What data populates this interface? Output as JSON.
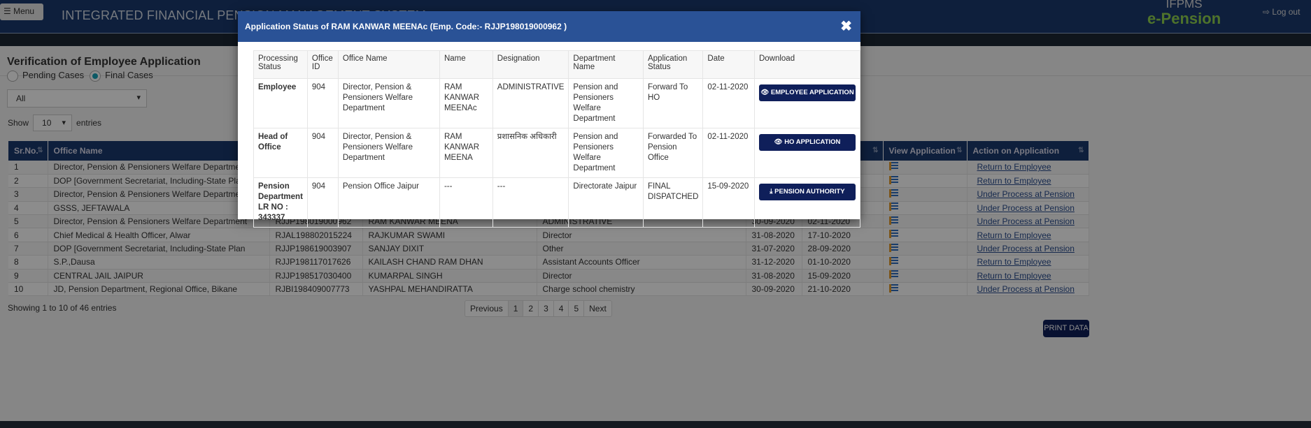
{
  "header": {
    "menu_label": "☰ Menu",
    "system_title": "INTEGRATED FINANCIAL PENSION MANAGEMENT SYSTEM",
    "brand_top": "IFPMS",
    "brand_bottom": "e-Pension",
    "logout_label": "⇨ Log out"
  },
  "page": {
    "title": "Verification of Employee Application",
    "radio_pending": "Pending Cases",
    "radio_final": "Final Cases",
    "selected_radio": "Final Cases",
    "filter_value": "All",
    "show_label": "Show",
    "entries_value": "10",
    "entries_label": "entries"
  },
  "table": {
    "headers": [
      "Sr.No.",
      "Office Name",
      "",
      "",
      "",
      "",
      "e",
      "View Application",
      "Action on Application"
    ],
    "rows": [
      [
        "1",
        "Director, Pension & Pensioners Welfare Department",
        "",
        "",
        "",
        "",
        "",
        "",
        "Return to Employee"
      ],
      [
        "2",
        "DOP [Government Secretariat, Including-State Plan]",
        "",
        "",
        "",
        "",
        "",
        "",
        "Return to Employee"
      ],
      [
        "3",
        "Director, Pension & Pensioners Welfare Department",
        "",
        "",
        "",
        "",
        "",
        "",
        "Under Process at Pension"
      ],
      [
        "4",
        "GSSS, JEFTAWALA",
        "",
        "",
        "",
        "",
        "",
        "",
        "Under Process at Pension"
      ],
      [
        "5",
        "Director, Pension & Pensioners Welfare Department",
        "RJJP198019000962",
        "RAM KANWAR MEENA",
        "ADMINISTRATIVE",
        "30-09-2020",
        "02-11-2020",
        "",
        "Under Process at Pension"
      ],
      [
        "6",
        "Chief Medical & Health Officer, Alwar",
        "RJAL198802015224",
        "RAJKUMAR SWAMI",
        "Director",
        "31-08-2020",
        "17-10-2020",
        "",
        "Return to Employee"
      ],
      [
        "7",
        "DOP [Government Secretariat, Including-State Plan",
        "RJJP198619003907",
        "SANJAY DIXIT",
        "Other",
        "31-07-2020",
        "28-09-2020",
        "",
        "Under Process at Pension"
      ],
      [
        "8",
        "S.P.,Dausa",
        "RJJP198117017626",
        "KAILASH CHAND RAM DHAN",
        "Assistant Accounts Officer",
        "31-12-2020",
        "01-10-2020",
        "",
        "Return to Employee"
      ],
      [
        "9",
        "CENTRAL JAIL JAIPUR",
        "RJJP198517030400",
        "KUMARPAL SINGH",
        "Director",
        "31-08-2020",
        "15-09-2020",
        "",
        "Return to Employee"
      ],
      [
        "10",
        "JD, Pension Department, Regional Office, Bikane",
        "RJBI198409007773",
        "YASHPAL MEHANDIRATTA",
        "Charge school chemistry",
        "30-09-2020",
        "21-10-2020",
        "",
        "Under Process at Pension"
      ]
    ]
  },
  "footer": {
    "showing": "Showing 1 to 10 of 46 entries",
    "pager": [
      "Previous",
      "1",
      "2",
      "3",
      "4",
      "5",
      "Next"
    ],
    "current_page": "1",
    "print_label": "PRINT DATA"
  },
  "modal": {
    "title": "Application Status of RAM KANWAR MEENAc (Emp. Code:- RJJP198019000962 )",
    "close": "✖",
    "headers": [
      "Processing Status",
      "Office ID",
      "Office Name",
      "Name",
      "Designation",
      "Department Name",
      "Application Status",
      "Date",
      "Download"
    ],
    "rows": [
      [
        "Employee",
        "904",
        "Director, Pension & Pensioners Welfare Department",
        "RAM KANWAR MEENAc",
        "ADMINISTRATIVE",
        "Pension and Pensioners Welfare Department",
        "Forward To HO",
        "02-11-2020",
        "EMPLOYEE APPLICATION"
      ],
      [
        "Head of Office",
        "904",
        "Director, Pension & Pensioners Welfare Department",
        "RAM KANWAR MEENA",
        "प्रशासनिक अधिकारी",
        "Pension and Pensioners Welfare Department",
        "Forwarded To Pension Office",
        "02-11-2020",
        "HO APPLICATION"
      ],
      [
        "Pension Department LR NO : 343337",
        "904",
        "Pension Office Jaipur",
        "---",
        "---",
        "Directorate Jaipur",
        "FINAL DISPATCHED",
        "15-09-2020",
        "PENSION AUTHORITY"
      ]
    ]
  },
  "colors": {
    "nav": "#1b3a6e",
    "modal_header": "#2a5296",
    "button": "#0f1f5a",
    "brand_green": "#8fd14f",
    "radio_accent": "#17a2b8"
  }
}
